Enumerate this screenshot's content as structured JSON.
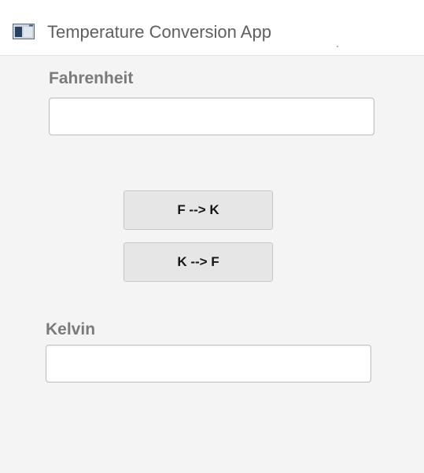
{
  "window": {
    "title": "Temperature Conversion App",
    "icon": "app-window-icon"
  },
  "form": {
    "fahrenheit_label": "Fahrenheit",
    "fahrenheit_value": "",
    "kelvin_label": "Kelvin",
    "kelvin_value": ""
  },
  "buttons": {
    "f_to_k": "F --> K",
    "k_to_f": "K --> F"
  },
  "colors": {
    "background": "#f4f4f4",
    "titlebar": "#ffffff",
    "label_text": "#7a7a7a",
    "button_face": "#e6e6e6",
    "button_text": "#151515"
  }
}
